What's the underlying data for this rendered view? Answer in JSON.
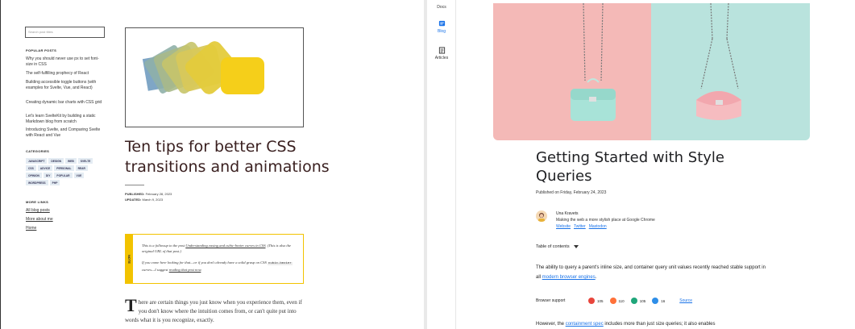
{
  "left": {
    "search_placeholder": "Search post titles",
    "popular_title": "POPULAR POSTS",
    "popular_posts": [
      "Why you should never use px to set font-size in CSS",
      "The self-fulfilling prophecy of React",
      "Building accessible toggle buttons (with examples for Svelte, Vue, and React)",
      "Creating dynamic bar charts with CSS grid",
      "Let's learn SvelteKit by building a static Markdown blog from scratch",
      "Introducing Svelte, and Comparing Svelte with React and Vue"
    ],
    "categories_title": "CATEGORIES",
    "categories": [
      "JAVASCRIPT",
      "DESIGN",
      "WEB",
      "SVELTE",
      "CSS",
      "ADVICE",
      "PERSONAL",
      "REAR",
      "OPINION",
      "DIY",
      "POPULAR",
      "VUE",
      "WORDPRESS",
      "PHP"
    ],
    "more_links_title": "MORE LINKS",
    "more_links": [
      "All blog posts",
      "More about me",
      "Home"
    ],
    "title": "Ten tips for better CSS transitions and animations",
    "published_label": "PUBLISHED:",
    "published_date": "February 28, 2023",
    "updated_label": "UPDATED:",
    "updated_date": "March 9, 2023",
    "note_label": "NOTE",
    "note_p1_a": "This is a followup to the post ",
    "note_p1_link": "Understanding easing and cubic-bezier curves in CSS",
    "note_p1_b": ". (This is also the original URL of that post.)",
    "note_p2_a": "If you come here looking for that—or if you don't already have a solid grasp on CSS ",
    "note_p2_code": "cubic-bezier",
    "note_p2_b": " curves—I suggest ",
    "note_p2_link": "reading that post now",
    "note_p2_c": ".",
    "dropcap": "T",
    "body": "here are certain things you just know when you experience them, even if you don't know where the intuition comes from, or can't quite put into words what it is you recognize, exactly."
  },
  "right": {
    "rail": [
      {
        "label": "Docs",
        "icon": "docs-icon",
        "active": false
      },
      {
        "label": "Blog",
        "icon": "blog-icon",
        "active": true
      },
      {
        "label": "Articles",
        "icon": "articles-icon",
        "active": false
      }
    ],
    "title": "Getting Started with Style Queries",
    "published": "Published on Friday, February 24, 2023",
    "author_name": "Una Kravets",
    "author_bio": "Making the web a more stylish place at Google Chrome",
    "author_links": [
      "Website",
      "Twitter",
      "Mastodon"
    ],
    "toc_label": "Table of contents",
    "para_a": "The ability to query a parent's inline size, and container query unit values recently reached stable support in all ",
    "para_link": "modern browser engines",
    "para_b": ".",
    "support_label": "Browser support",
    "browsers": [
      {
        "name": "chrome",
        "version": "105",
        "color": "#e8453c"
      },
      {
        "name": "firefox",
        "version": "110",
        "color": "#ff7139"
      },
      {
        "name": "edge",
        "version": "105",
        "color": "#1fa67a"
      },
      {
        "name": "safari",
        "version": "16",
        "color": "#2e8ee8"
      }
    ],
    "source_label": "Source",
    "cut_a": "However, the ",
    "cut_link": "containment spec",
    "cut_b": " includes more than just size queries; it also enables"
  }
}
